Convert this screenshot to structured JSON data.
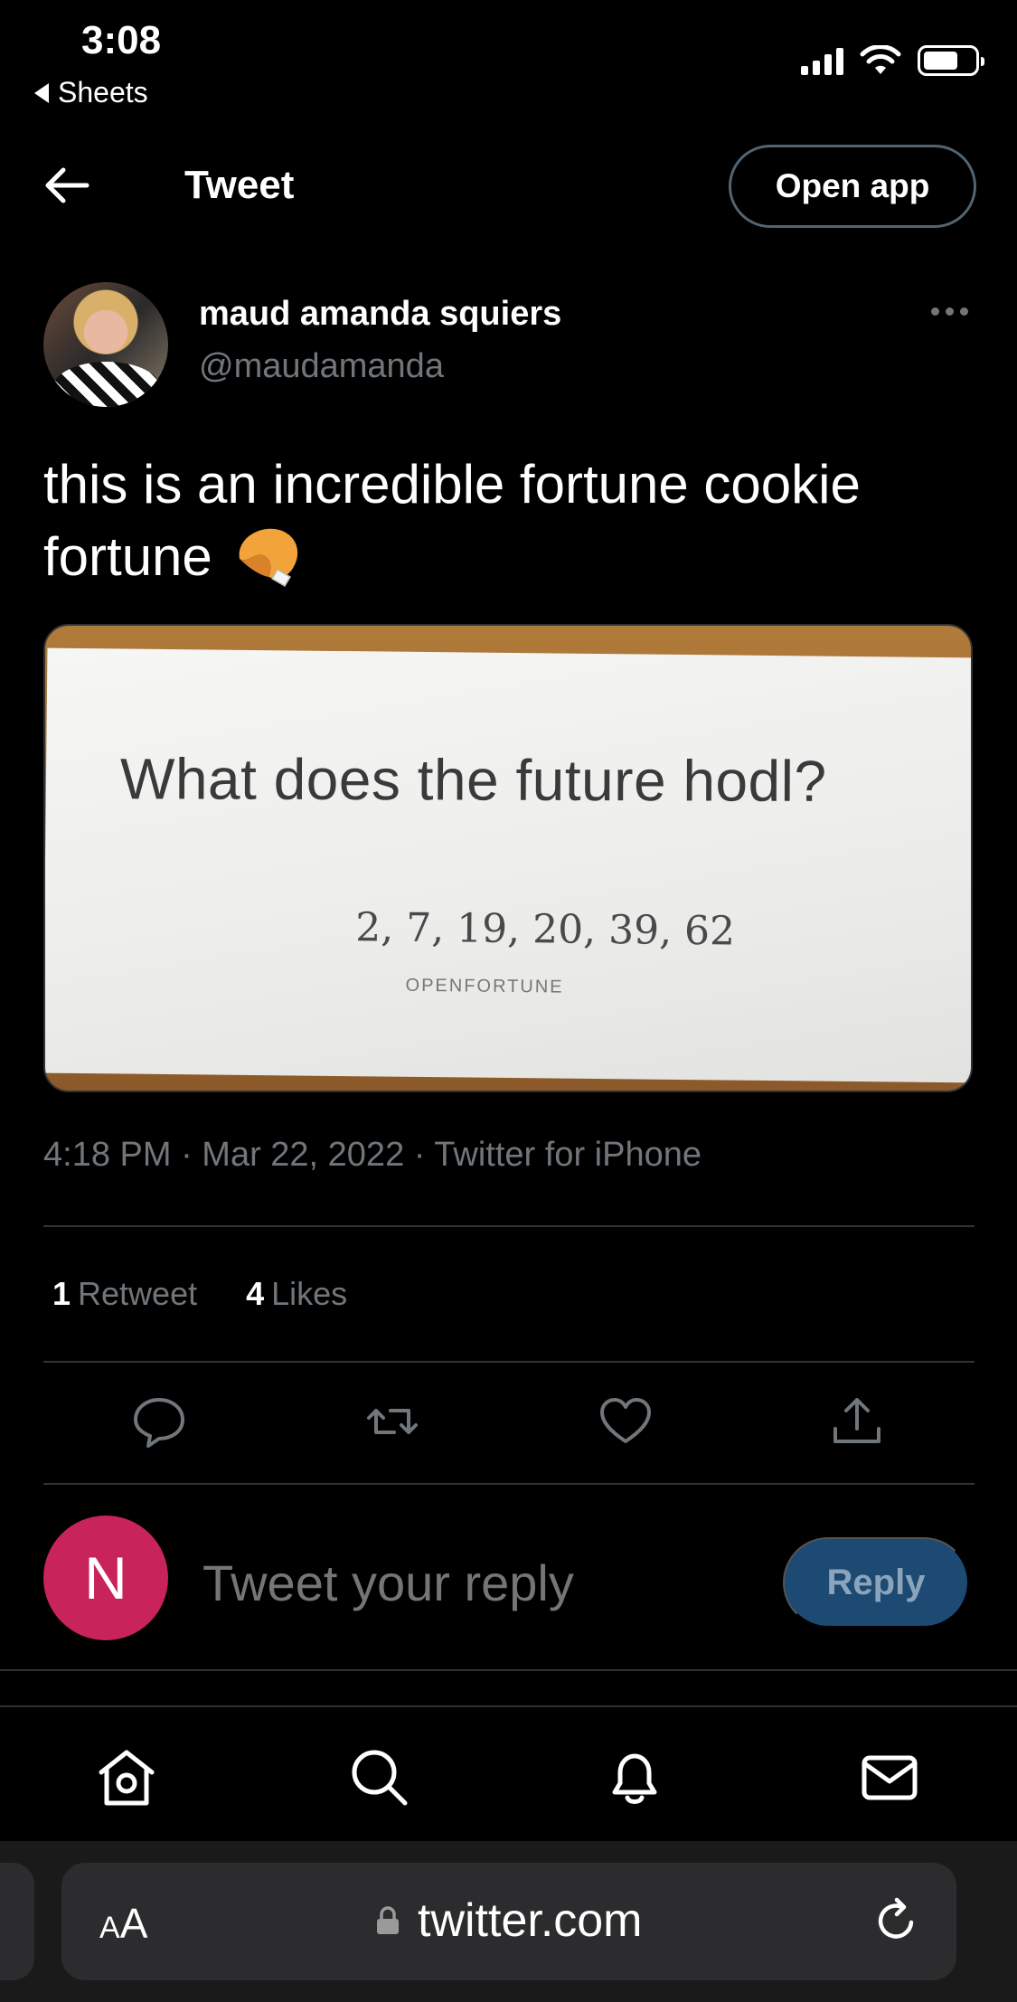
{
  "status_bar": {
    "time": "3:08",
    "back_app": "Sheets"
  },
  "header": {
    "title": "Tweet",
    "open_app_label": "Open app"
  },
  "tweet": {
    "author_name": "maud amanda squiers",
    "author_handle": "@maudamanda",
    "text": "this is an incredible fortune cookie fortune",
    "emoji": "fortune-cookie-emoji",
    "image": {
      "main_text": "What does the future hodl?",
      "numbers": "2, 7, 19, 20, 39, 62",
      "brand": "OPENFORTUNE"
    },
    "timestamp": "4:18 PM · Mar 22, 2022 · Twitter for iPhone",
    "retweets_count": "1",
    "retweets_label": "Retweet",
    "likes_count": "4",
    "likes_label": "Likes"
  },
  "actions": [
    "reply-icon",
    "retweet-icon",
    "like-icon",
    "share-icon"
  ],
  "reply_box": {
    "avatar_letter": "N",
    "placeholder": "Tweet your reply",
    "button_label": "Reply"
  },
  "bottom_nav": [
    "home-icon",
    "search-icon",
    "notifications-icon",
    "messages-icon"
  ],
  "browser": {
    "text_size_label_small": "A",
    "text_size_label_large": "A",
    "url": "twitter.com"
  },
  "colors": {
    "background": "#000000",
    "secondary_text": "#71767b",
    "divider": "#2f3336",
    "reply_avatar": "#c9235b",
    "reply_button": "#1d4a72"
  }
}
